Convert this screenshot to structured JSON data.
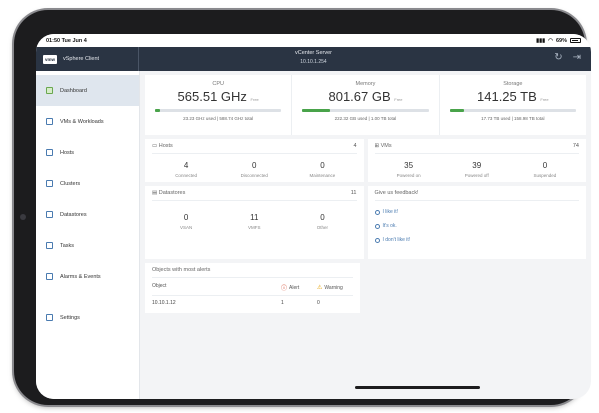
{
  "status_bar": {
    "time": "01:50 Tue Jun 4",
    "battery": "69%"
  },
  "header": {
    "logo": "vmw",
    "app_name": "vSphere Client",
    "server_title": "vCenter Server",
    "server_ip": "10.10.1.254"
  },
  "icons": {
    "refresh": "↻",
    "logout": "⇥",
    "alert": "ⓘ",
    "warning": "⚠"
  },
  "sidebar": {
    "items": [
      {
        "label": "Dashboard",
        "icon": "dashboard-icon"
      },
      {
        "label": "VMs & Workloads",
        "icon": "vm-icon"
      },
      {
        "label": "Hosts",
        "icon": "host-icon"
      },
      {
        "label": "Clusters",
        "icon": "cluster-icon"
      },
      {
        "label": "Datastores",
        "icon": "datastore-icon"
      },
      {
        "label": "Tasks",
        "icon": "tasks-icon"
      },
      {
        "label": "Alarms & Events",
        "icon": "alarm-icon"
      },
      {
        "label": "Settings",
        "icon": "settings-icon"
      }
    ]
  },
  "metrics": {
    "cpu": {
      "label": "CPU",
      "value": "565.51 GHz",
      "unit": "Free",
      "used": "23.23 GHz used",
      "total": "588.74 GHz total",
      "fill_pct": 4
    },
    "memory": {
      "label": "Memory",
      "value": "801.67 GB",
      "unit": "Free",
      "used": "222.32 GB used",
      "total": "1.00 TB total",
      "fill_pct": 22
    },
    "storage": {
      "label": "Storage",
      "value": "141.25 TB",
      "unit": "Free",
      "used": "17.73 TB used",
      "total": "158.98 TB total",
      "fill_pct": 11
    }
  },
  "hosts": {
    "title": "Hosts",
    "count": "4",
    "stats": [
      {
        "value": "4",
        "label": "Connected"
      },
      {
        "value": "0",
        "label": "Disconnected"
      },
      {
        "value": "0",
        "label": "Maintenance"
      }
    ]
  },
  "vms": {
    "title": "VMs",
    "count": "74",
    "stats": [
      {
        "value": "35",
        "label": "Powered on"
      },
      {
        "value": "39",
        "label": "Powered off"
      },
      {
        "value": "0",
        "label": "Suspended"
      }
    ]
  },
  "datastores": {
    "title": "Datastores",
    "count": "11",
    "stats": [
      {
        "value": "0",
        "label": "VSAN"
      },
      {
        "value": "11",
        "label": "VMFS"
      },
      {
        "value": "0",
        "label": "Other"
      }
    ]
  },
  "feedback": {
    "title": "Give us feedback!",
    "options": [
      "I like it!",
      "It's ok.",
      "I don't like it!"
    ]
  },
  "alerts": {
    "title": "Objects with most alerts",
    "col_object": "Object",
    "col_alert": "Alert",
    "col_warning": "Warning",
    "rows": [
      {
        "object": "10.10.1.12",
        "alert": "1",
        "warning": "0"
      }
    ]
  },
  "colors": {
    "header_bg": "#2a3443",
    "progress": "#49a34a",
    "link": "#4a7bb0"
  }
}
